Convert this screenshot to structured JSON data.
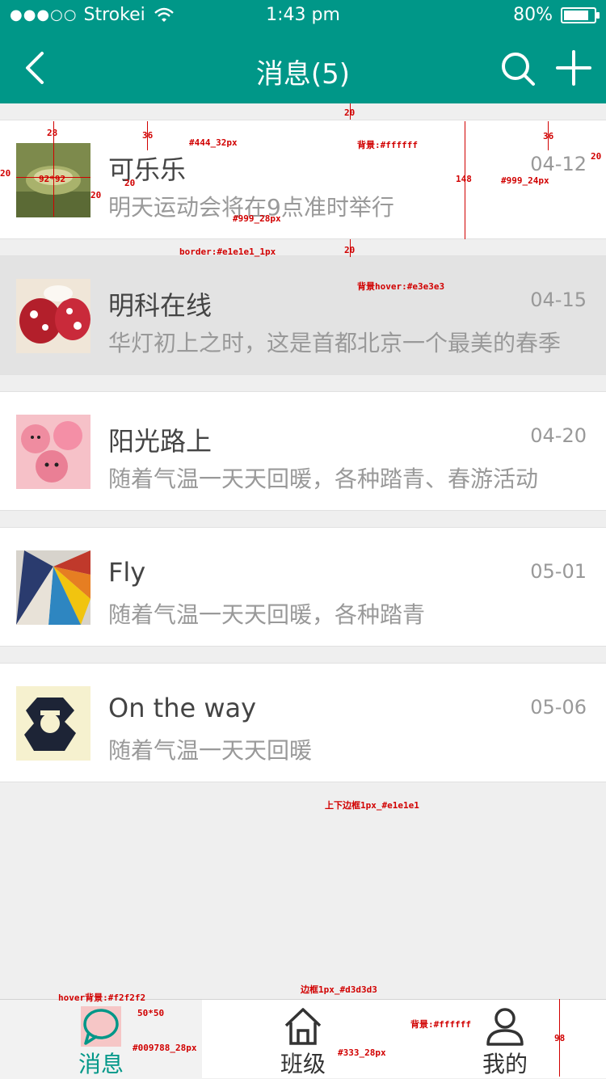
{
  "status_bar": {
    "signal": "●●●○○",
    "carrier": "Strokei",
    "time": "1:43 pm",
    "battery": "80%"
  },
  "nav": {
    "title": "消息(5)"
  },
  "messages": [
    {
      "name": "可乐乐",
      "preview": "明天运动会将在9点准时举行",
      "date": "04-12"
    },
    {
      "name": "明科在线",
      "preview": "华灯初上之时，这是首都北京一个最美的春季",
      "date": "04-15"
    },
    {
      "name": "阳光路上",
      "preview": "随着气温一天天回暖，各种踏青、春游活动",
      "date": "04-20"
    },
    {
      "name": "Fly",
      "preview": "随着气温一天天回暖，各种踏青",
      "date": "05-01"
    },
    {
      "name": "On the way",
      "preview": "随着气温一天天回暖",
      "date": "05-06"
    }
  ],
  "tabs": [
    {
      "label": "消息",
      "icon": "chat-bubble-icon"
    },
    {
      "label": "班级",
      "icon": "home-icon"
    },
    {
      "label": "我的",
      "icon": "user-icon"
    }
  ],
  "colors": {
    "brand": "#009788",
    "text_primary": "#444444",
    "text_secondary": "#999999",
    "hover_bg": "#e3e3e3",
    "border": "#e1e1e1"
  },
  "annotations": {
    "a20_top": "20",
    "a28": "28",
    "a36_left": "36",
    "a20_side_left": "20",
    "a92": "92*92",
    "a20_gap": "20",
    "a20_side_right": "20",
    "a444": "#444_32px",
    "abg": "背景:#ffffff",
    "a999_28": "#999_28px",
    "a148": "148",
    "a36_right": "36",
    "a999_24": "#999_24px",
    "a20_right_edge": "20",
    "aborder": "border:#e1e1e1_1px",
    "a20_bottom": "20",
    "ahover": "背景hover:#e3e3e3",
    "aborder2": "上下边框1px_#e1e1e1",
    "ahover_tab": "hover背景:#f2f2f2",
    "aborder_tab": "边框1px_#d3d3d3",
    "a5050": "50*50",
    "abrand": "#009788_28px",
    "a333": "#333_28px",
    "abg_tab": "背景:#ffffff",
    "a98": "98"
  }
}
